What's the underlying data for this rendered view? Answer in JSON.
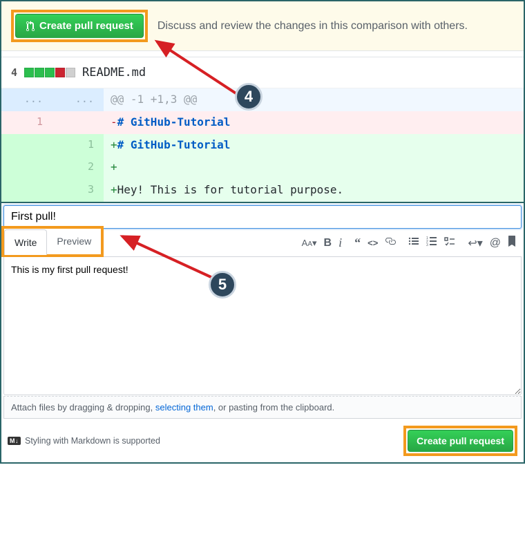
{
  "banner": {
    "button_label": "Create pull request",
    "description": "Discuss and review the changes in this comparison with others."
  },
  "diff": {
    "change_count": "4",
    "blocks": [
      "g",
      "g",
      "g",
      "r",
      "n"
    ],
    "filename": "README.md",
    "hunk_header": "@@ -1 +1,3 @@",
    "rows": [
      {
        "type": "del",
        "old": "1",
        "new": "",
        "prefix": "-",
        "heading": "# GitHub-Tutorial",
        "body": ""
      },
      {
        "type": "add",
        "old": "",
        "new": "1",
        "prefix": "+",
        "heading": "# GitHub-Tutorial",
        "body": ""
      },
      {
        "type": "add",
        "old": "",
        "new": "2",
        "prefix": "+",
        "heading": "",
        "body": ""
      },
      {
        "type": "add",
        "old": "",
        "new": "3",
        "prefix": "+",
        "heading": "",
        "body": "Hey! This is for tutorial purpose."
      }
    ]
  },
  "form": {
    "title_value": "First pull!",
    "tabs": {
      "write": "Write",
      "preview": "Preview"
    },
    "description_value": "This is my first pull request!",
    "attach_prefix": "Attach files by dragging & dropping, ",
    "attach_link": "selecting them",
    "attach_suffix": ", or pasting from the clipboard.",
    "markdown_badge": "M↓",
    "markdown_text": "Styling with Markdown is supported",
    "submit_label": "Create pull request"
  },
  "annotations": {
    "step4": "4",
    "step5": "5"
  }
}
